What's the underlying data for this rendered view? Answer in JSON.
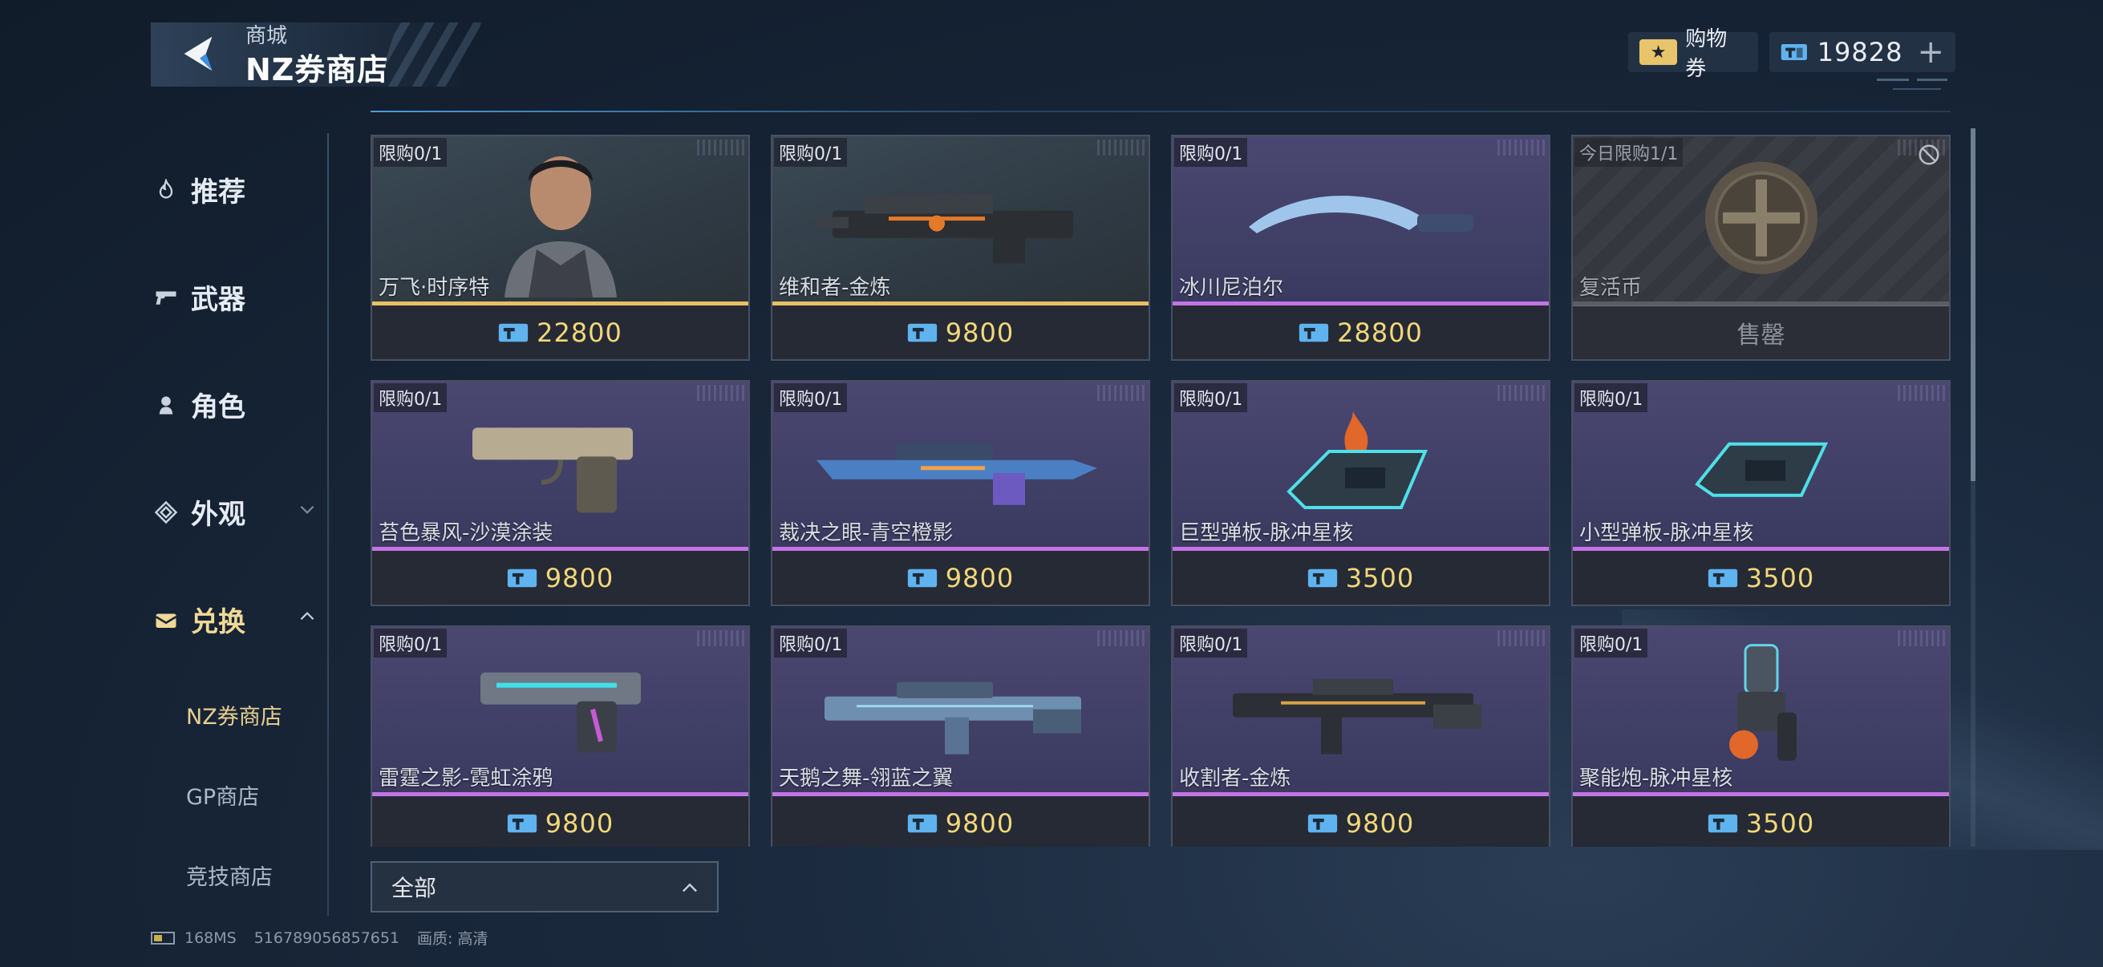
{
  "header": {
    "breadcrumb": "商城",
    "title": "NZ券商店"
  },
  "currency": {
    "coupon_icon": "★",
    "coupon_label": "购物券",
    "nz_amount": "19828",
    "plus": "+"
  },
  "sidebar": {
    "items": [
      {
        "label": "推荐",
        "icon": "flame-icon"
      },
      {
        "label": "武器",
        "icon": "pistol-icon"
      },
      {
        "label": "角色",
        "icon": "person-icon"
      },
      {
        "label": "外观",
        "icon": "diamond-icon"
      },
      {
        "label": "兑换",
        "icon": "mailbox-icon"
      }
    ],
    "sub_items": [
      {
        "label": "NZ券商店"
      },
      {
        "label": "GP商店"
      },
      {
        "label": "竞技商店"
      }
    ]
  },
  "items": [
    {
      "limit": "限购0/1",
      "name": "万飞·时序特",
      "price": "22800",
      "rarity": "gold"
    },
    {
      "limit": "限购0/1",
      "name": "维和者-金炼",
      "price": "9800",
      "rarity": "gold"
    },
    {
      "limit": "限购0/1",
      "name": "冰川尼泊尔",
      "price": "28800",
      "rarity": "purple"
    },
    {
      "limit": "今日限购1/1",
      "name": "复活币",
      "price": "售罄",
      "rarity": "grey"
    },
    {
      "limit": "限购0/1",
      "name": "苔色暴风-沙漠涂装",
      "price": "9800",
      "rarity": "purple"
    },
    {
      "limit": "限购0/1",
      "name": "裁决之眼-青空橙影",
      "price": "9800",
      "rarity": "purple"
    },
    {
      "limit": "限购0/1",
      "name": "巨型弹板-脉冲星核",
      "price": "3500",
      "rarity": "purple"
    },
    {
      "limit": "限购0/1",
      "name": "小型弹板-脉冲星核",
      "price": "3500",
      "rarity": "purple"
    },
    {
      "limit": "限购0/1",
      "name": "雷霆之影-霓虹涂鸦",
      "price": "9800",
      "rarity": "purple"
    },
    {
      "limit": "限购0/1",
      "name": "天鹅之舞-翎蓝之翼",
      "price": "9800",
      "rarity": "purple"
    },
    {
      "limit": "限购0/1",
      "name": "收割者-金炼",
      "price": "9800",
      "rarity": "purple"
    },
    {
      "limit": "限购0/1",
      "name": "聚能炮-脉冲星核",
      "price": "3500",
      "rarity": "purple"
    }
  ],
  "filter": {
    "selected": "全部"
  },
  "status": {
    "ping": "168MS",
    "uid": "516789056857651",
    "quality": "画质: 高清"
  },
  "colors": {
    "price_gold": "#f2d77a",
    "rarity_gold": "#e6c064",
    "rarity_purple": "#c374e6",
    "active_nav": "#f0d996",
    "accent_blue": "#50aaf0"
  }
}
